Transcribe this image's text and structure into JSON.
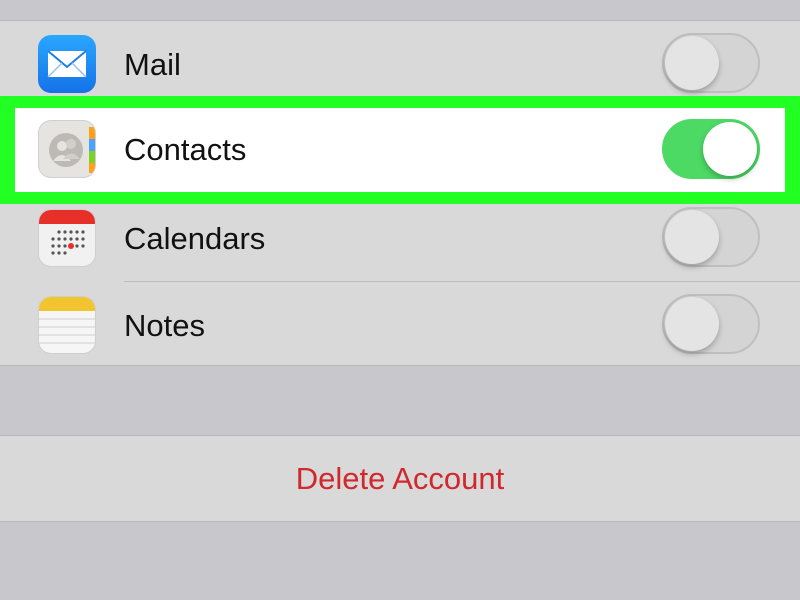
{
  "rows": [
    {
      "label": "Mail",
      "icon": "mail-icon",
      "enabled": false
    },
    {
      "label": "Contacts",
      "icon": "contacts-icon",
      "enabled": true
    },
    {
      "label": "Calendars",
      "icon": "calendar-icon",
      "enabled": false
    },
    {
      "label": "Notes",
      "icon": "notes-icon",
      "enabled": false
    }
  ],
  "delete_account_label": "Delete Account",
  "colors": {
    "highlight": "#22ff22",
    "toggle_on": "#4cd964",
    "destructive": "#d0282d",
    "mail_icon": "#1e8ef5"
  }
}
